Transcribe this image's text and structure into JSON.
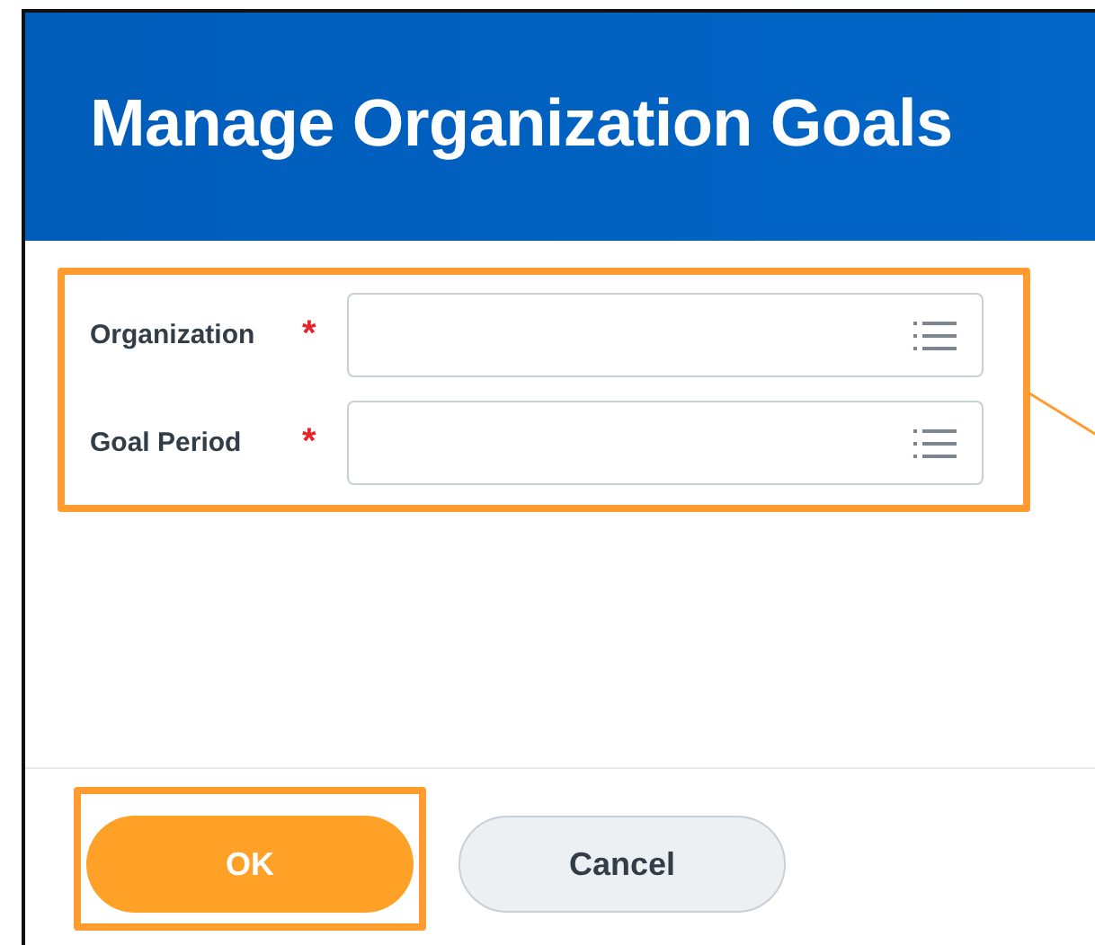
{
  "dialog": {
    "title": "Manage Organization Goals"
  },
  "fields": [
    {
      "label": "Organization",
      "required": true
    },
    {
      "label": "Goal Period",
      "required": true
    }
  ],
  "required_mark": "*",
  "buttons": [
    {
      "label": "OK",
      "kind": "primary",
      "highlighted": true
    },
    {
      "label": "Cancel",
      "kind": "secondary",
      "highlighted": false
    }
  ]
}
